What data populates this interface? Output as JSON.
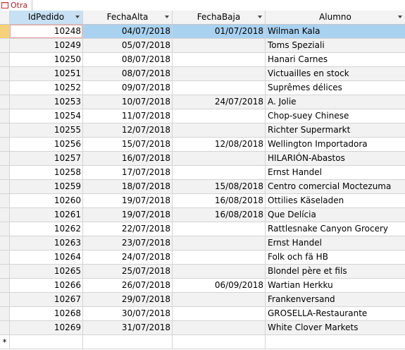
{
  "tab": {
    "label": "Otra"
  },
  "columns": [
    "IdPedido",
    "FechaAlta",
    "FechaBaja",
    "Alumno"
  ],
  "rows": [
    [
      "10248",
      "04/07/2018",
      "01/07/2018",
      "Wilman Kala"
    ],
    [
      "10249",
      "05/07/2018",
      "",
      "Toms Speziali"
    ],
    [
      "10250",
      "08/07/2018",
      "",
      "Hanari Carnes"
    ],
    [
      "10251",
      "08/07/2018",
      "",
      "Victuailles en stock"
    ],
    [
      "10252",
      "09/07/2018",
      "",
      "Suprêmes délices"
    ],
    [
      "10253",
      "10/07/2018",
      "24/07/2018",
      "A. Jolie"
    ],
    [
      "10254",
      "11/07/2018",
      "",
      "Chop-suey Chinese"
    ],
    [
      "10255",
      "12/07/2018",
      "",
      "Richter Supermarkt"
    ],
    [
      "10256",
      "15/07/2018",
      "12/08/2018",
      "Wellington Importadora"
    ],
    [
      "10257",
      "16/07/2018",
      "",
      "HILARIÓN-Abastos"
    ],
    [
      "10258",
      "17/07/2018",
      "",
      "Ernst Handel"
    ],
    [
      "10259",
      "18/07/2018",
      "15/08/2018",
      "Centro comercial Moctezuma"
    ],
    [
      "10260",
      "19/07/2018",
      "16/08/2018",
      "Ottilies Käseladen"
    ],
    [
      "10261",
      "19/07/2018",
      "16/08/2018",
      "Que Delícia"
    ],
    [
      "10262",
      "22/07/2018",
      "",
      "Rattlesnake Canyon Grocery"
    ],
    [
      "10263",
      "23/07/2018",
      "",
      "Ernst Handel"
    ],
    [
      "10264",
      "24/07/2018",
      "",
      "Folk och fä HB"
    ],
    [
      "10265",
      "25/07/2018",
      "",
      "Blondel père et fils"
    ],
    [
      "10266",
      "26/07/2018",
      "06/09/2018",
      "Wartian Herkku"
    ],
    [
      "10267",
      "29/07/2018",
      "",
      "Frankenversand"
    ],
    [
      "10268",
      "30/07/2018",
      "",
      "GROSELLA-Restaurante"
    ],
    [
      "10269",
      "31/07/2018",
      "",
      "White Clover Markets"
    ]
  ],
  "new_record_marker": "*",
  "selected_row": 0
}
